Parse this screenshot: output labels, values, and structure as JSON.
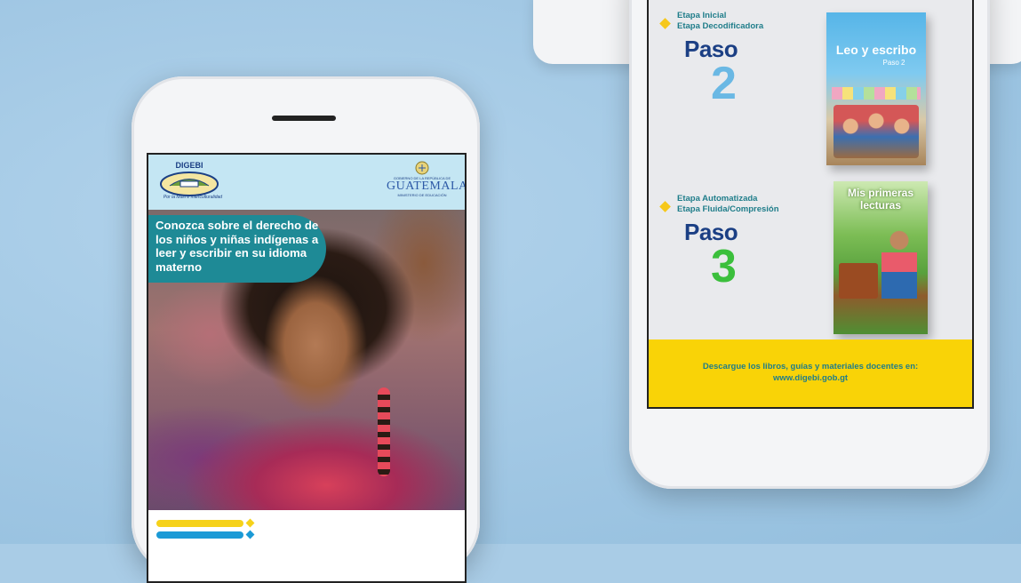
{
  "phone_left": {
    "header": {
      "digebi_logo_text": "DIGEBI",
      "digebi_slogan": "Por la Multi e Interculturalidad",
      "gov_top": "GOBIERNO DE LA REPÚBLICA DE",
      "gov_name": "GUATEMALA",
      "gov_sub": "MINISTERIO DE EDUCACIÓN"
    },
    "banner_text": "Conozca sobre el derecho de los niños y niñas indígenas a leer y escribir en su idioma materno",
    "colors": {
      "banner": "#1e8a96",
      "header_bg": "#c4e6f3",
      "bar_yellow": "#f6d21a",
      "bar_blue": "#1b9ad6"
    }
  },
  "phone_right": {
    "steps": [
      {
        "stage_line1": "Etapa Inicial",
        "stage_line2": "Etapa Decodificadora",
        "paso_label": "Paso",
        "paso_number": "2",
        "number_color": "#6ab8e4",
        "book_title": "Leo y escribo",
        "book_subtitle": "Paso 2"
      },
      {
        "stage_line1": "Etapa Automatizada",
        "stage_line2": "Etapa Fluida/Compresión",
        "paso_label": "Paso",
        "paso_number": "3",
        "number_color": "#3bbf3c",
        "book_title": "Mis primeras lecturas",
        "book_subtitle": ""
      }
    ],
    "footer": {
      "line1": "Descargue los libros, guías y materiales docentes en:",
      "line2": "www.digebi.gob.gt"
    }
  }
}
